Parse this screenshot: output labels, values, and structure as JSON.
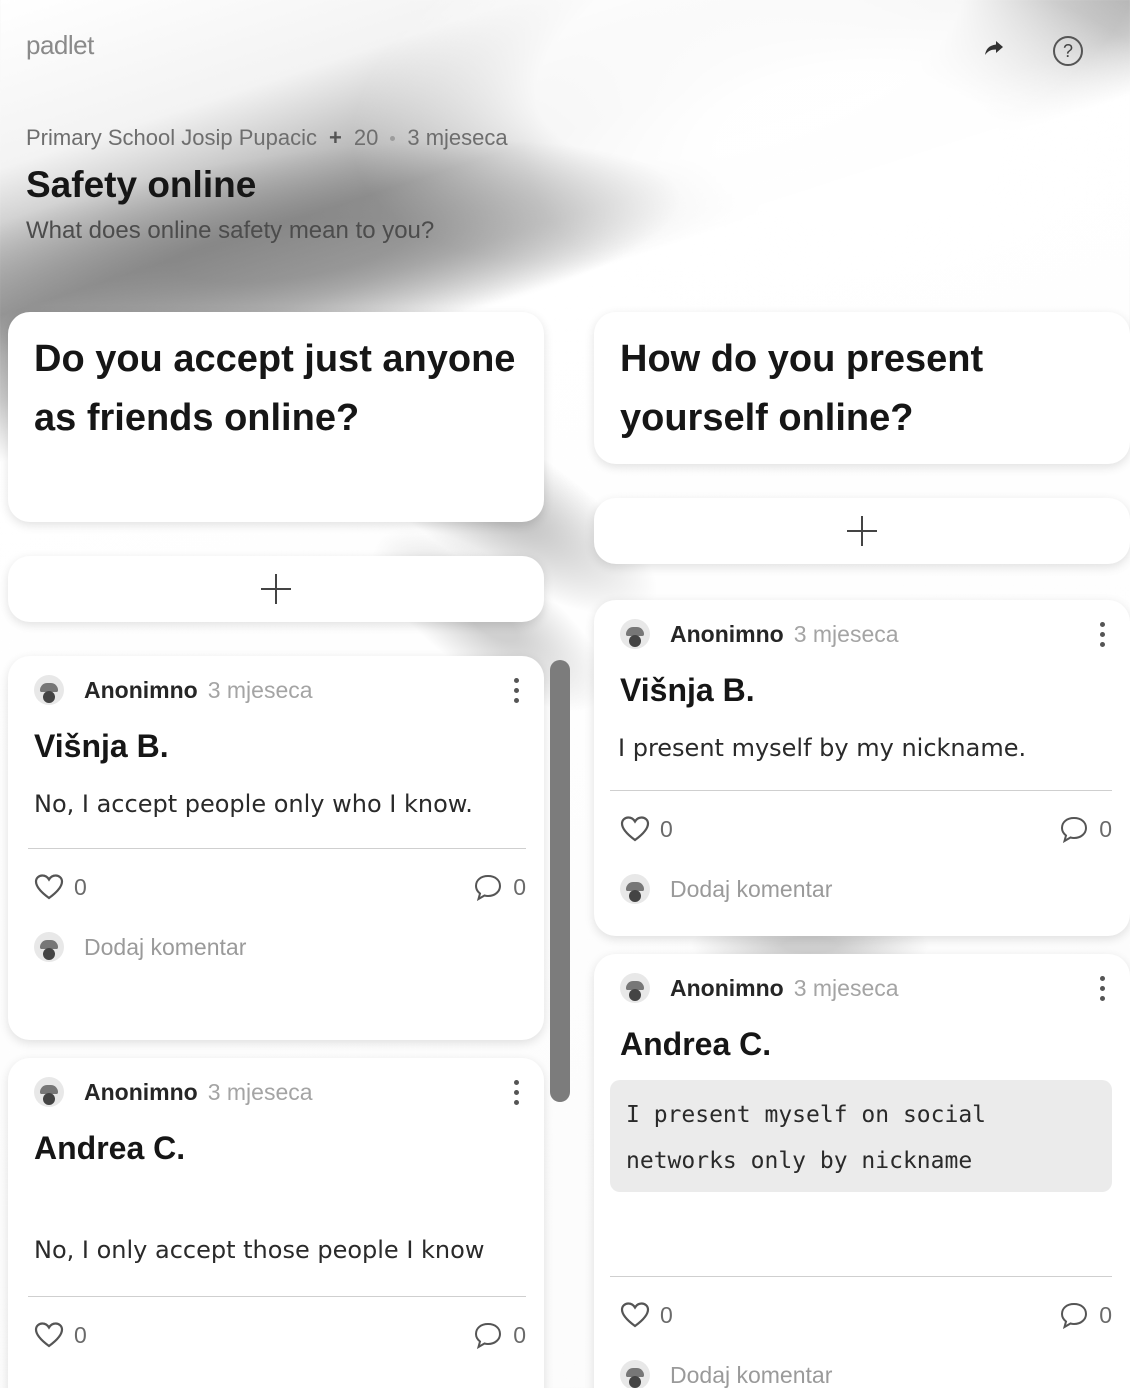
{
  "app": {
    "logo": "padlet"
  },
  "board": {
    "author": "Primary School Josip Pupacic",
    "contrib_plus": "+",
    "contrib_count": "20",
    "age": "3 mjeseca",
    "title": "Safety online",
    "description": "What does online safety mean to you?"
  },
  "icons": {
    "share": "share-arrow-icon",
    "help": "help-icon",
    "heart": "heart-icon",
    "comment": "comment-icon",
    "more": "more-vertical-icon",
    "add": "plus-icon"
  },
  "sections": [
    {
      "title": "Do you accept just anyone as friends online?",
      "posts": [
        {
          "author": "Anonimno",
          "time": "3 mjeseca",
          "title": "Višnja B.",
          "body": "No, I accept people only who I know.",
          "likes": "0",
          "comments": "0",
          "comment_placeholder": "Dodaj komentar"
        },
        {
          "author": "Anonimno",
          "time": "3 mjeseca",
          "title": "Andrea C.",
          "body": "No, I only accept those people I know",
          "likes": "0",
          "comments": "0"
        }
      ]
    },
    {
      "title": "How do you present yourself online?",
      "posts": [
        {
          "author": "Anonimno",
          "time": "3 mjeseca",
          "title": "Višnja B.",
          "body": "I present myself by my nickname.",
          "likes": "0",
          "comments": "0",
          "comment_placeholder": "Dodaj komentar"
        },
        {
          "author": "Anonimno",
          "time": "3 mjeseca",
          "title": "Andrea C.",
          "body": "I present myself on social networks only by nickname",
          "likes": "0",
          "comments": "0",
          "comment_placeholder": "Dodaj komentar"
        }
      ]
    }
  ]
}
